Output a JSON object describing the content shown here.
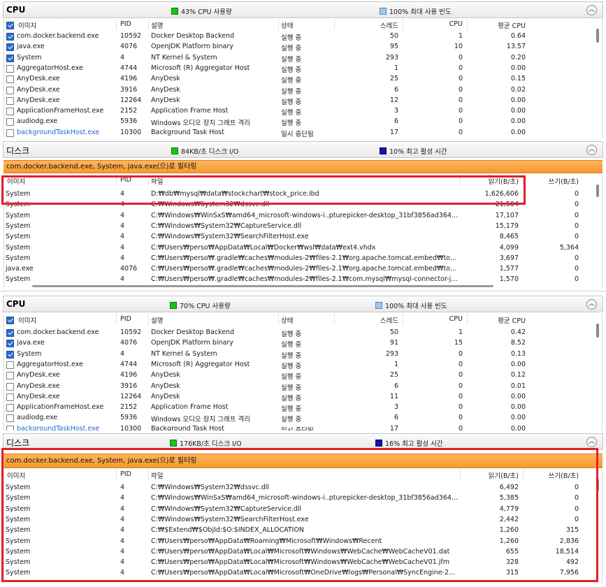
{
  "top": {
    "cpu": {
      "title": "CPU",
      "legend_usage": "43% CPU 사용량",
      "legend_freq": "100% 최대 사용 빈도",
      "columns": [
        "이미지",
        "PID",
        "설명",
        "상태",
        "스레드",
        "CPU",
        "평균 CPU"
      ],
      "rows": [
        {
          "checked": true,
          "image": "com.docker.backend.exe",
          "pid": "10592",
          "desc": "Docker Desktop Backend",
          "status": "실행 중",
          "threads": "50",
          "cpu": "1",
          "avg": "0.64"
        },
        {
          "checked": true,
          "image": "java.exe",
          "pid": "4076",
          "desc": "OpenJDK Platform binary",
          "status": "실행 중",
          "threads": "95",
          "cpu": "10",
          "avg": "13.57"
        },
        {
          "checked": true,
          "image": "System",
          "pid": "4",
          "desc": "NT Kernel & System",
          "status": "실행 중",
          "threads": "293",
          "cpu": "0",
          "avg": "0.20"
        },
        {
          "checked": false,
          "image": "AggregatorHost.exe",
          "pid": "4744",
          "desc": "Microsoft (R) Aggregator Host",
          "status": "실행 중",
          "threads": "1",
          "cpu": "0",
          "avg": "0.00"
        },
        {
          "checked": false,
          "image": "AnyDesk.exe",
          "pid": "4196",
          "desc": "AnyDesk",
          "status": "실행 중",
          "threads": "25",
          "cpu": "0",
          "avg": "0.15"
        },
        {
          "checked": false,
          "image": "AnyDesk.exe",
          "pid": "3916",
          "desc": "AnyDesk",
          "status": "실행 중",
          "threads": "6",
          "cpu": "0",
          "avg": "0.02"
        },
        {
          "checked": false,
          "image": "AnyDesk.exe",
          "pid": "12264",
          "desc": "AnyDesk",
          "status": "실행 중",
          "threads": "12",
          "cpu": "0",
          "avg": "0.00"
        },
        {
          "checked": false,
          "image": "ApplicationFrameHost.exe",
          "pid": "2152",
          "desc": "Application Frame Host",
          "status": "실행 중",
          "threads": "3",
          "cpu": "0",
          "avg": "0.00"
        },
        {
          "checked": false,
          "image": "audiodg.exe",
          "pid": "5936",
          "desc": "Windows 오디오 장치 그래프 격리",
          "status": "실행 중",
          "threads": "6",
          "cpu": "0",
          "avg": "0.00"
        },
        {
          "checked": false,
          "image": "backgroundTaskHost.exe",
          "pid": "10300",
          "desc": "Background Task Host",
          "status": "일시 중단됨",
          "threads": "17",
          "cpu": "0",
          "avg": "0.00"
        }
      ]
    },
    "disk": {
      "title": "디스크",
      "legend_io": "84KB/초 디스크 I/O",
      "legend_active": "10% 최고 활성 시간",
      "filter": "com.docker.backend.exe, System, java.exe(으)로 필터링",
      "columns": [
        "이미지",
        "PID",
        "파일",
        "읽기(B/초)",
        "쓰기(B/초)"
      ],
      "rows": [
        {
          "image": "System",
          "pid": "4",
          "file": "D:₩db₩mysql₩data₩stockchart₩stock_price.ibd",
          "read": "1,626,606",
          "write": "0"
        },
        {
          "image": "System",
          "pid": "4",
          "file": "C:₩Windows₩System32₩dssvc.dll",
          "read": "21,504",
          "write": "0"
        },
        {
          "image": "System",
          "pid": "4",
          "file": "C:₩Windows₩WinSxS₩amd64_microsoft-windows-i..pturepicker-desktop_31bf3856ad364e35_...",
          "read": "17,107",
          "write": "0"
        },
        {
          "image": "System",
          "pid": "4",
          "file": "C:₩Windows₩System32₩CaptureService.dll",
          "read": "15,179",
          "write": "0"
        },
        {
          "image": "System",
          "pid": "4",
          "file": "C:₩Windows₩System32₩SearchFilterHost.exe",
          "read": "8,465",
          "write": "0"
        },
        {
          "image": "System",
          "pid": "4",
          "file": "C:₩Users₩perso₩AppData₩Local₩Docker₩wsl₩data₩ext4.vhdx",
          "read": "4,099",
          "write": "5,364"
        },
        {
          "image": "System",
          "pid": "4",
          "file": "C:₩Users₩perso₩.gradle₩caches₩modules-2₩files-2.1₩org.apache.tomcat.embed₩tomcat-e...",
          "read": "3,697",
          "write": "0"
        },
        {
          "image": "java.exe",
          "pid": "4076",
          "file": "C:₩Users₩perso₩.gradle₩caches₩modules-2₩files-2.1₩org.apache.tomcat.embed₩tomcat-e...",
          "read": "1,577",
          "write": "0"
        },
        {
          "image": "System",
          "pid": "4",
          "file": "C:₩Users₩perso₩.gradle₩caches₩modules-2₩files-2.1₩com.mysql₩mysql-connector-j₩8.0.33...",
          "read": "1,570",
          "write": "0"
        }
      ]
    }
  },
  "bottom": {
    "cpu": {
      "title": "CPU",
      "legend_usage": "70% CPU 사용량",
      "legend_freq": "100% 최대 사용 빈도",
      "columns": [
        "이미지",
        "PID",
        "설명",
        "상태",
        "스레드",
        "CPU",
        "평균 CPU"
      ],
      "rows": [
        {
          "checked": true,
          "image": "com.docker.backend.exe",
          "pid": "10592",
          "desc": "Docker Desktop Backend",
          "status": "실행 중",
          "threads": "50",
          "cpu": "1",
          "avg": "0.42"
        },
        {
          "checked": true,
          "image": "java.exe",
          "pid": "4076",
          "desc": "OpenJDK Platform binary",
          "status": "실행 중",
          "threads": "91",
          "cpu": "15",
          "avg": "8.52"
        },
        {
          "checked": true,
          "image": "System",
          "pid": "4",
          "desc": "NT Kernel & System",
          "status": "실행 중",
          "threads": "293",
          "cpu": "0",
          "avg": "0.13"
        },
        {
          "checked": false,
          "image": "AggregatorHost.exe",
          "pid": "4744",
          "desc": "Microsoft (R) Aggregator Host",
          "status": "실행 중",
          "threads": "1",
          "cpu": "0",
          "avg": "0.00"
        },
        {
          "checked": false,
          "image": "AnyDesk.exe",
          "pid": "4196",
          "desc": "AnyDesk",
          "status": "실행 중",
          "threads": "25",
          "cpu": "0",
          "avg": "0.12"
        },
        {
          "checked": false,
          "image": "AnyDesk.exe",
          "pid": "3916",
          "desc": "AnyDesk",
          "status": "실행 중",
          "threads": "6",
          "cpu": "0",
          "avg": "0.01"
        },
        {
          "checked": false,
          "image": "AnyDesk.exe",
          "pid": "12264",
          "desc": "AnyDesk",
          "status": "실행 중",
          "threads": "11",
          "cpu": "0",
          "avg": "0.00"
        },
        {
          "checked": false,
          "image": "ApplicationFrameHost.exe",
          "pid": "2152",
          "desc": "Application Frame Host",
          "status": "실행 중",
          "threads": "3",
          "cpu": "0",
          "avg": "0.00"
        },
        {
          "checked": false,
          "image": "audiodg.exe",
          "pid": "5936",
          "desc": "Windows 오디오 장치 그래프 격리",
          "status": "실행 중",
          "threads": "6",
          "cpu": "0",
          "avg": "0.00"
        },
        {
          "checked": false,
          "image": "backgroundTaskHost.exe",
          "pid": "10300",
          "desc": "Background Task Host",
          "status": "일시 중단됨",
          "threads": "17",
          "cpu": "0",
          "avg": "0.00"
        }
      ]
    },
    "disk": {
      "title": "디스크",
      "legend_io": "176KB/초 디스크 I/O",
      "legend_active": "16% 최고 활성 시간",
      "filter": "com.docker.backend.exe, System, java.exe(으)로 필터링",
      "columns": [
        "이미지",
        "PID",
        "파일",
        "읽기(B/초)",
        "쓰기(B/초)"
      ],
      "rows": [
        {
          "image": "System",
          "pid": "4",
          "file": "C:₩Windows₩System32₩dssvc.dll",
          "read": "6,492",
          "write": "0"
        },
        {
          "image": "System",
          "pid": "4",
          "file": "C:₩Windows₩WinSxS₩amd64_microsoft-windows-i..pturepicker-desktop_31bf3856ad364e35_...",
          "read": "5,385",
          "write": "0"
        },
        {
          "image": "System",
          "pid": "4",
          "file": "C:₩Windows₩System32₩CaptureService.dll",
          "read": "4,779",
          "write": "0"
        },
        {
          "image": "System",
          "pid": "4",
          "file": "C:₩Windows₩System32₩SearchFilterHost.exe",
          "read": "2,442",
          "write": "0"
        },
        {
          "image": "System",
          "pid": "4",
          "file": "C:₩$Extend₩$ObjId:$O:$INDEX_ALLOCATION",
          "read": "1,260",
          "write": "315"
        },
        {
          "image": "System",
          "pid": "4",
          "file": "C:₩Users₩perso₩AppData₩Roaming₩Microsoft₩Windows₩Recent",
          "read": "1,260",
          "write": "2,836"
        },
        {
          "image": "System",
          "pid": "4",
          "file": "C:₩Users₩perso₩AppData₩Local₩Microsoft₩Windows₩WebCache₩WebCacheV01.dat",
          "read": "655",
          "write": "18,514"
        },
        {
          "image": "System",
          "pid": "4",
          "file": "C:₩Users₩perso₩AppData₩Local₩Microsoft₩Windows₩WebCache₩WebCacheV01.jfm",
          "read": "328",
          "write": "492"
        },
        {
          "image": "System",
          "pid": "4",
          "file": "C:₩Users₩perso₩AppData₩Local₩Microsoft₩OneDrive₩logs₩Personal₩SyncEngine-2023-11...",
          "read": "315",
          "write": "7,956"
        }
      ]
    }
  },
  "colors": {
    "highlight": "#e0202a",
    "filter_bar": "#f49a2f",
    "checkbox": "#2d6dd0",
    "cpu_legend": "#16c316",
    "freq_legend": "#9cc8ee",
    "active_legend": "#1212b6"
  }
}
